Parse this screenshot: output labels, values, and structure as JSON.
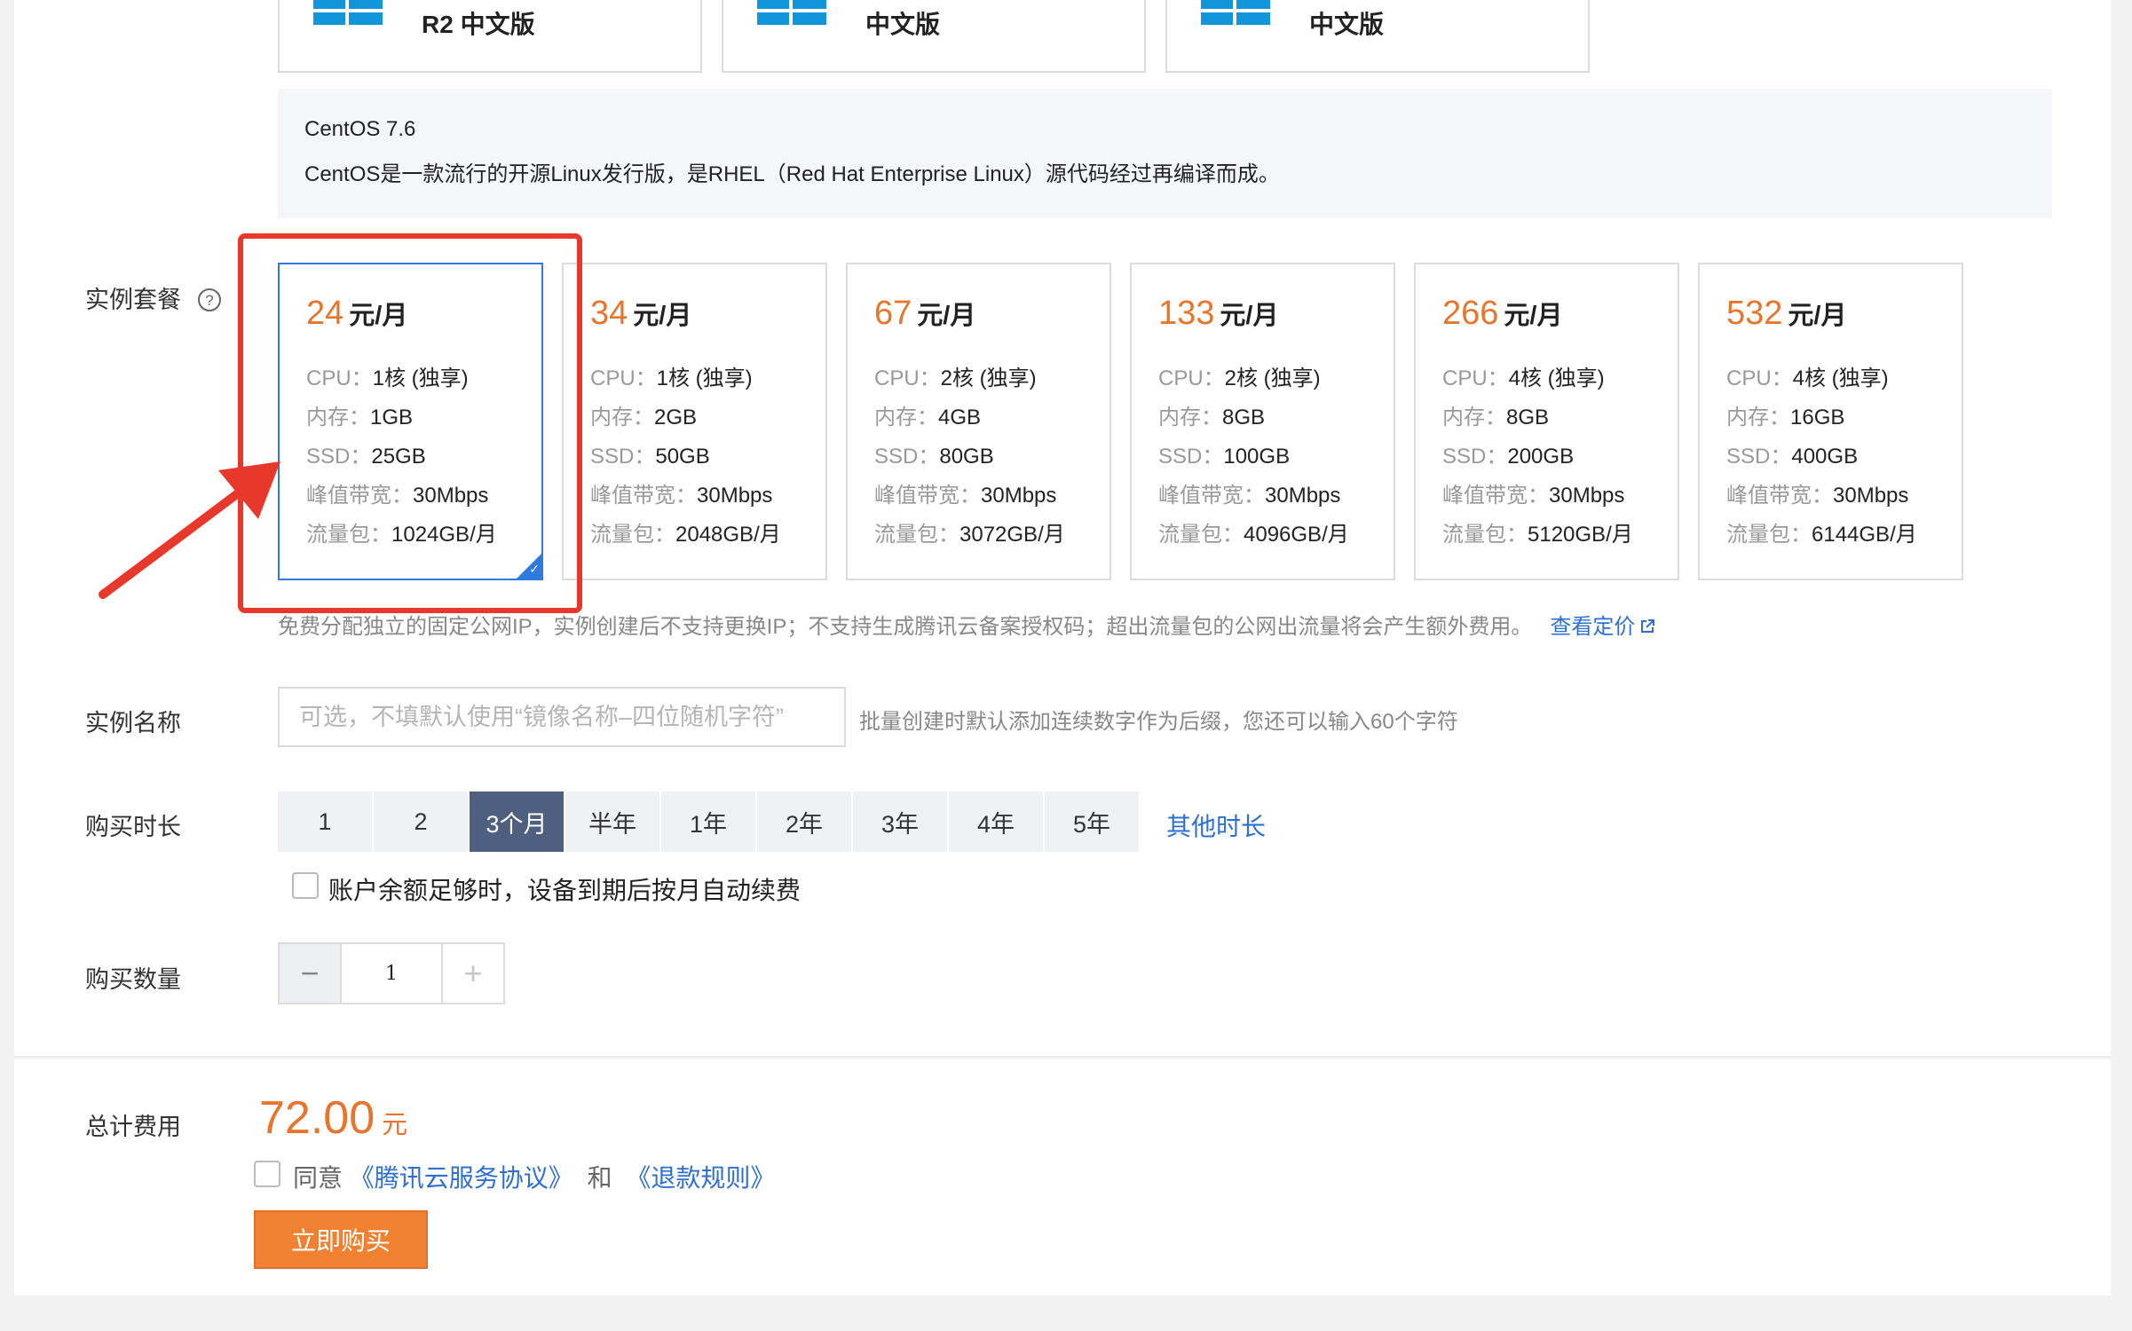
{
  "image_cards": [
    {
      "label": "R2 中文版"
    },
    {
      "label": "中文版"
    },
    {
      "label": "中文版"
    }
  ],
  "description": {
    "title": "CentOS 7.6",
    "text": "CentOS是一款流行的开源Linux发行版，是RHEL（Red Hat Enterprise Linux）源代码经过再编译而成。"
  },
  "plan_section": {
    "label": "实例套餐",
    "help_icon": "question-circle-icon",
    "plans": [
      {
        "price": "24",
        "unit": "元/月",
        "cpu": "1核 (独享)",
        "mem": "1GB",
        "ssd": "25GB",
        "bw": "30Mbps",
        "traffic": "1024GB/月",
        "selected": true
      },
      {
        "price": "34",
        "unit": "元/月",
        "cpu": "1核 (独享)",
        "mem": "2GB",
        "ssd": "50GB",
        "bw": "30Mbps",
        "traffic": "2048GB/月",
        "selected": false
      },
      {
        "price": "67",
        "unit": "元/月",
        "cpu": "2核 (独享)",
        "mem": "4GB",
        "ssd": "80GB",
        "bw": "30Mbps",
        "traffic": "3072GB/月",
        "selected": false
      },
      {
        "price": "133",
        "unit": "元/月",
        "cpu": "2核 (独享)",
        "mem": "8GB",
        "ssd": "100GB",
        "bw": "30Mbps",
        "traffic": "4096GB/月",
        "selected": false
      },
      {
        "price": "266",
        "unit": "元/月",
        "cpu": "4核 (独享)",
        "mem": "8GB",
        "ssd": "200GB",
        "bw": "30Mbps",
        "traffic": "5120GB/月",
        "selected": false
      },
      {
        "price": "532",
        "unit": "元/月",
        "cpu": "4核 (独享)",
        "mem": "16GB",
        "ssd": "400GB",
        "bw": "30Mbps",
        "traffic": "6144GB/月",
        "selected": false
      }
    ],
    "keys": {
      "cpu": "CPU：",
      "mem": "内存：",
      "ssd": "SSD：",
      "bw": "峰值带宽：",
      "traffic": "流量包："
    },
    "note": "免费分配独立的固定公网IP，实例创建后不支持更换IP；不支持生成腾讯云备案授权码；超出流量包的公网出流量将会产生额外费用。",
    "note_link": "查看定价",
    "note_link_icon": "external-link-icon"
  },
  "name_section": {
    "label": "实例名称",
    "placeholder": "可选，不填默认使用“镜像名称–四位随机字符”",
    "hint": "批量创建时默认添加连续数字作为后缀，您还可以输入60个字符"
  },
  "duration_section": {
    "label": "购买时长",
    "options": [
      "1",
      "2",
      "3个月",
      "半年",
      "1年",
      "2年",
      "3年",
      "4年",
      "5年"
    ],
    "active_index": 2,
    "other": "其他时长",
    "auto_renew": "账户余额足够时，设备到期后按月自动续费"
  },
  "quantity_section": {
    "label": "购买数量",
    "value": "1",
    "minus": "−",
    "plus": "+"
  },
  "footer": {
    "label": "总计费用",
    "amount": "72.00",
    "currency": "元",
    "agree_prefix": "同意",
    "agree_link1": "《腾讯云服务协议》",
    "agree_and": "和",
    "agree_link2": "《退款规则》",
    "buy_label": "立即购买"
  },
  "colors": {
    "accent_orange": "#e8752c",
    "link_blue": "#2e6fd3",
    "selected_blue": "#2e7be0",
    "highlight_red": "#e8382b",
    "active_duration": "#4f5f80"
  }
}
